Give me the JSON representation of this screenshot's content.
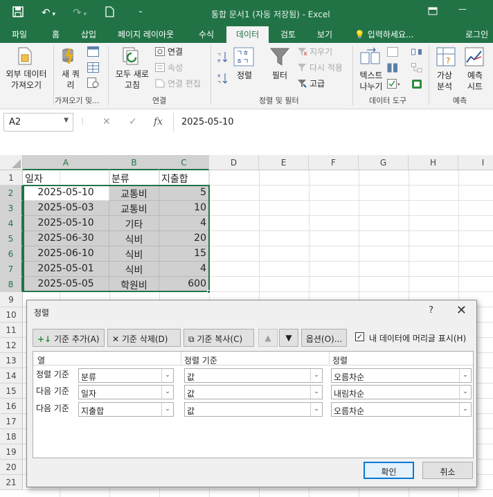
{
  "window": {
    "title": "통합 문서1 (자동 저장됨) - Excel"
  },
  "ribbon_tabs": [
    "파일",
    "홈",
    "삽입",
    "페이지 레이아웃",
    "수식",
    "데이터",
    "검토",
    "보기"
  ],
  "active_tab": "데이터",
  "tell_me": "입력하세요...",
  "login": "로그인",
  "ribbon": {
    "external_data": "외부 데이터\n가져오기",
    "new_query": "새 쿼\n리",
    "group_get": "가져오기 및...",
    "refresh_all": "모두 새로\n고침",
    "connections": "연결",
    "properties": "속성",
    "edit_links": "연결 편집",
    "group_connections": "연결",
    "sort": "정렬",
    "filter": "필터",
    "clear": "지우기",
    "reapply": "다시 적용",
    "advanced": "고급",
    "group_sort": "정렬 및 필터",
    "text_to_columns": "텍스트\n나누기",
    "group_tools": "데이터 도구",
    "what_if": "가상\n분석",
    "forecast_sheet": "예측\n시트",
    "group_forecast": "예측"
  },
  "formula_bar": {
    "name_box": "A2",
    "formula": "2025-05-10"
  },
  "columns": [
    "A",
    "B",
    "C",
    "D",
    "E",
    "F",
    "G",
    "H",
    "I"
  ],
  "rows": [
    "1",
    "2",
    "3",
    "4",
    "5",
    "6",
    "7",
    "8",
    "9",
    "10",
    "11",
    "12",
    "13",
    "14",
    "15",
    "16",
    "17",
    "18",
    "19",
    "20",
    "21"
  ],
  "sheet": {
    "headers": [
      "일자",
      "분류",
      "지출합"
    ],
    "data": [
      [
        "2025-05-10",
        "교통비",
        "5"
      ],
      [
        "2025-05-03",
        "교통비",
        "10"
      ],
      [
        "2025-05-10",
        "기타",
        "4"
      ],
      [
        "2025-06-30",
        "식비",
        "20"
      ],
      [
        "2025-06-10",
        "식비",
        "15"
      ],
      [
        "2025-05-01",
        "식비",
        "4"
      ],
      [
        "2025-05-05",
        "학원비",
        "600"
      ]
    ]
  },
  "sort_dialog": {
    "title": "정렬",
    "help": "?",
    "add_level": "기준 추가(A)",
    "delete_level": "기준 삭제(D)",
    "copy_level": "기준 복사(C)",
    "options": "옵션(O)...",
    "has_headers_label": "내 데이터에 머리글 표시(H)",
    "has_headers_checked": true,
    "col_header": "열",
    "sorton_header": "정렬 기준",
    "order_header": "정렬",
    "levels": [
      {
        "label": "정렬 기준",
        "column": "분류",
        "sort_on": "값",
        "order": "오름차순"
      },
      {
        "label": "다음 기준",
        "column": "일자",
        "sort_on": "값",
        "order": "내림차순"
      },
      {
        "label": "다음 기준",
        "column": "지출합",
        "sort_on": "값",
        "order": "오름차순"
      }
    ],
    "ok": "확인",
    "cancel": "취소"
  }
}
